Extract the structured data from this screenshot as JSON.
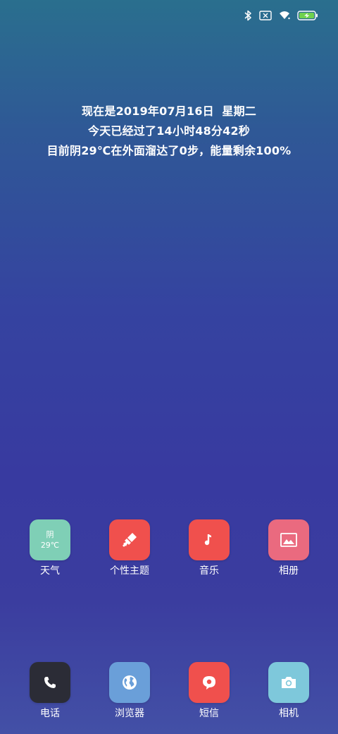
{
  "status_bar": {
    "icons": [
      "bluetooth-icon",
      "no-sim-icon",
      "wifi-icon",
      "battery-charging-icon"
    ]
  },
  "info": {
    "line1": "现在是2019年07月16日  星期二",
    "line2": "今天已经过了14小时48分42秒",
    "line3": "目前阴29℃在外面溜达了0步，能量剩余100%"
  },
  "apps": [
    {
      "label": "天气",
      "icon": "weather-icon",
      "condition": "阴",
      "temp": "29℃",
      "color": "#7fcfb6"
    },
    {
      "label": "个性主题",
      "icon": "brush-icon",
      "color": "#f0504d"
    },
    {
      "label": "音乐",
      "icon": "music-note-icon",
      "color": "#f0504d"
    },
    {
      "label": "相册",
      "icon": "image-icon",
      "color": "#ea6a7f"
    }
  ],
  "dock": [
    {
      "label": "电话",
      "icon": "phone-icon",
      "color": "#2b2c36"
    },
    {
      "label": "浏览器",
      "icon": "globe-icon",
      "color": "#6a9fd9"
    },
    {
      "label": "短信",
      "icon": "message-icon",
      "color": "#f0504d"
    },
    {
      "label": "相机",
      "icon": "camera-icon",
      "color": "#7ec8db"
    }
  ]
}
